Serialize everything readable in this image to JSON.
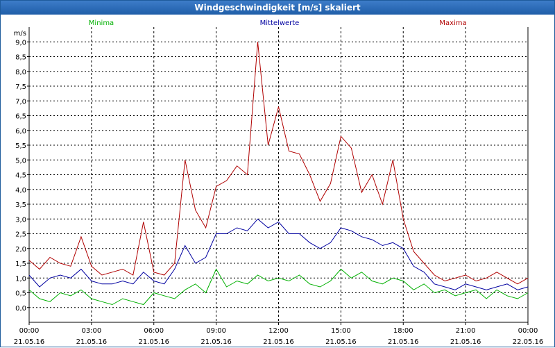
{
  "title": "Windgeschwindigkeit [m/s] skaliert",
  "chart_data": {
    "type": "line",
    "title": "Windgeschwindigkeit [m/s] skaliert",
    "ylabel": "m/s",
    "ylim": [
      -0.5,
      9.5
    ],
    "xlim": [
      0,
      24
    ],
    "grid": true,
    "legend_placement": "top",
    "y_ticks": [
      "0,0",
      "0,5",
      "1,0",
      "1,5",
      "2,0",
      "2,5",
      "3,0",
      "3,5",
      "4,0",
      "4,5",
      "5,0",
      "5,5",
      "6,0",
      "6,5",
      "7,0",
      "7,5",
      "8,0",
      "8,5",
      "9,0"
    ],
    "x_ticks": [
      {
        "time": "00:00",
        "date": "21.05.16"
      },
      {
        "time": "03:00",
        "date": "21.05.16"
      },
      {
        "time": "06:00",
        "date": "21.05.16"
      },
      {
        "time": "09:00",
        "date": "21.05.16"
      },
      {
        "time": "12:00",
        "date": "21.05.16"
      },
      {
        "time": "15:00",
        "date": "21.05.16"
      },
      {
        "time": "18:00",
        "date": "21.05.16"
      },
      {
        "time": "21:00",
        "date": "21.05.16"
      },
      {
        "time": "00:00",
        "date": "22.05.16"
      }
    ],
    "x": [
      0,
      0.5,
      1,
      1.5,
      2,
      2.5,
      3,
      3.5,
      4,
      4.5,
      5,
      5.5,
      6,
      6.5,
      7,
      7.5,
      8,
      8.5,
      9,
      9.5,
      10,
      10.5,
      11,
      11.5,
      12,
      12.5,
      13,
      13.5,
      14,
      14.5,
      15,
      15.5,
      16,
      16.5,
      17,
      17.5,
      18,
      18.5,
      19,
      19.5,
      20,
      20.5,
      21,
      21.5,
      22,
      22.5,
      23,
      23.5,
      24
    ],
    "series": [
      {
        "name": "Minima",
        "color": "#00b000",
        "values": [
          0.6,
          0.3,
          0.2,
          0.5,
          0.4,
          0.6,
          0.3,
          0.2,
          0.1,
          0.3,
          0.2,
          0.1,
          0.5,
          0.4,
          0.3,
          0.6,
          0.8,
          0.5,
          1.3,
          0.7,
          0.9,
          0.8,
          1.1,
          0.9,
          1.0,
          0.9,
          1.1,
          0.8,
          0.7,
          0.9,
          1.3,
          1.0,
          1.2,
          0.9,
          0.8,
          1.0,
          0.9,
          0.6,
          0.8,
          0.5,
          0.6,
          0.4,
          0.5,
          0.6,
          0.3,
          0.6,
          0.4,
          0.3,
          0.5
        ]
      },
      {
        "name": "Mittelwerte",
        "color": "#0000a0",
        "values": [
          1.1,
          0.7,
          1.0,
          1.1,
          1.0,
          1.3,
          0.9,
          0.8,
          0.8,
          0.9,
          0.8,
          1.2,
          0.9,
          0.8,
          1.3,
          2.1,
          1.5,
          1.7,
          2.5,
          2.5,
          2.7,
          2.6,
          3.0,
          2.7,
          2.9,
          2.5,
          2.5,
          2.2,
          2.0,
          2.2,
          2.7,
          2.6,
          2.4,
          2.3,
          2.1,
          2.2,
          2.0,
          1.4,
          1.2,
          0.8,
          0.7,
          0.6,
          0.8,
          0.7,
          0.6,
          0.7,
          0.8,
          0.6,
          0.7
        ]
      },
      {
        "name": "Maxima",
        "color": "#b00000",
        "values": [
          1.6,
          1.3,
          1.7,
          1.5,
          1.4,
          2.4,
          1.4,
          1.1,
          1.2,
          1.3,
          1.1,
          2.9,
          1.2,
          1.1,
          1.5,
          5.0,
          3.3,
          2.7,
          4.1,
          4.3,
          4.8,
          4.5,
          9.0,
          5.5,
          6.8,
          5.3,
          5.2,
          4.5,
          3.6,
          4.2,
          5.8,
          5.4,
          3.9,
          4.5,
          3.5,
          5.0,
          3.0,
          1.9,
          1.5,
          1.1,
          0.9,
          1.0,
          1.1,
          0.9,
          1.0,
          1.2,
          1.0,
          0.8,
          1.0
        ]
      }
    ]
  }
}
